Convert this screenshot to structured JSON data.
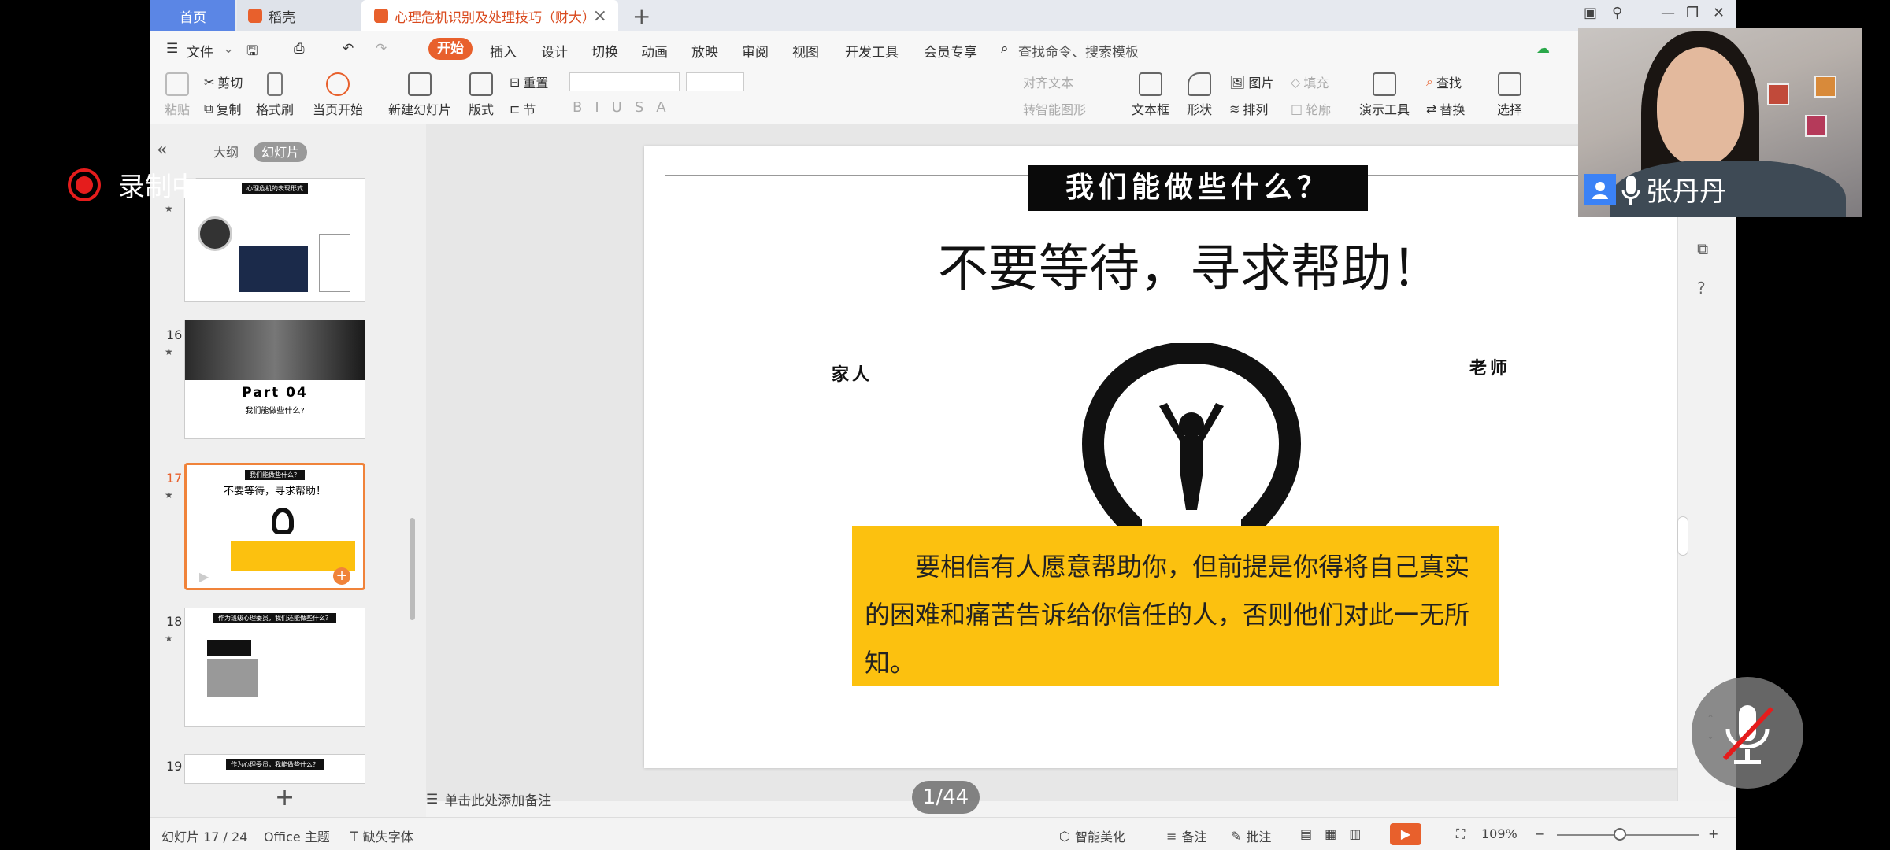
{
  "tabs": {
    "home": "首页",
    "daoke": "稻壳",
    "doc": "心理危机识别及处理技巧（财大）",
    "new": "+"
  },
  "menu": {
    "file": "文件",
    "items": [
      "开始",
      "插入",
      "设计",
      "切换",
      "动画",
      "放映",
      "审阅",
      "视图",
      "开发工具",
      "会员专享"
    ],
    "search": "查找命令、搜索模板"
  },
  "ribbon": {
    "paste": "粘贴",
    "cut": "剪切",
    "copy": "复制",
    "format_painter": "格式刷",
    "play_from_current": "当页开始",
    "new_slide": "新建幻灯片",
    "layout": "版式",
    "reset": "重置",
    "section": "节",
    "align_text": "对齐文本",
    "smart_shape": "转智能图形",
    "textbox": "文本框",
    "shape": "形状",
    "picture": "图片",
    "fill": "填充",
    "arrange": "排列",
    "outline": "轮廓",
    "present_tools": "演示工具",
    "find": "查找",
    "replace": "替换",
    "select": "选择"
  },
  "panel": {
    "outline_tab": "大纲",
    "slides_tab": "幻灯片",
    "slides": [
      {
        "num": "",
        "title": "心理危机的表现形式"
      },
      {
        "num": "16",
        "title": "Part  04",
        "subtitle": "我们能做些什么?"
      },
      {
        "num": "17",
        "title": "我们能做些什么？",
        "subtitle": "不要等待，寻求帮助！"
      },
      {
        "num": "18",
        "title": "作为班级心理委员，我们还能做些什么？"
      },
      {
        "num": "19",
        "title": "作为心理委员，我能做些什么？"
      }
    ]
  },
  "slide": {
    "banner": "我们能做些什么？",
    "headline": "不要等待，寻求帮助！",
    "label_left": "家人",
    "label_right": "老师",
    "body": "要相信有人愿意帮助你，但前提是你得将自己真实的困难和痛苦告诉给你信任的人，否则他们对此一无所知。"
  },
  "notes_placeholder": "单击此处添加备注",
  "page_indicator": "1/44",
  "status": {
    "slide_count": "幻灯片 17 / 24",
    "theme": "Office 主题",
    "missing_fonts": "缺失字体",
    "smart_beautify": "智能美化",
    "notes": "备注",
    "comments": "批注",
    "zoom": "109%"
  },
  "overlay": {
    "recording": "录制中",
    "presenter_name": "张丹丹"
  },
  "colors": {
    "accent": "#e8602c",
    "highlight_box": "#fcc10f",
    "home_tab": "#5b86e5",
    "recording": "#e51c1c"
  }
}
